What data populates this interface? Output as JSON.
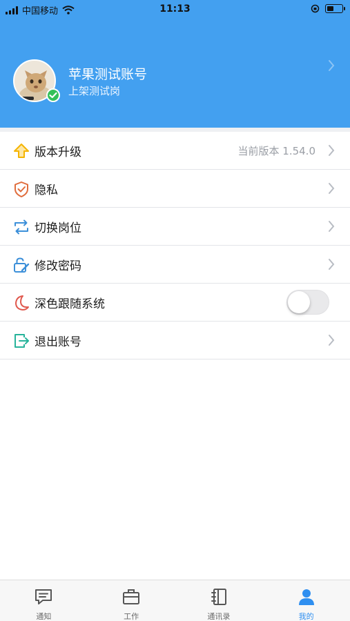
{
  "status_bar": {
    "carrier": "中国移动",
    "time": "11:13",
    "battery_level": 0.45
  },
  "profile": {
    "name": "苹果测试账号",
    "role": "上架测试岗"
  },
  "menu": [
    {
      "label": "版本升级",
      "value": "当前版本 1.54.0",
      "icon": "upgrade-arrow-icon",
      "icon_color": "#f5b400"
    },
    {
      "label": "隐私",
      "icon": "shield-icon",
      "icon_color": "#e06c3c"
    },
    {
      "label": "切换岗位",
      "icon": "switch-icon",
      "icon_color": "#3b8fd9"
    },
    {
      "label": "修改密码",
      "icon": "lock-edit-icon",
      "icon_color": "#3b8fd9"
    },
    {
      "label": "深色跟随系统",
      "icon": "moon-icon",
      "icon_color": "#e0594e",
      "toggle_on": false
    },
    {
      "label": "退出账号",
      "icon": "logout-icon",
      "icon_color": "#26b39a"
    }
  ],
  "tabs": [
    {
      "label": "通知",
      "icon": "chat-icon",
      "active": false
    },
    {
      "label": "工作",
      "icon": "briefcase-icon",
      "active": false
    },
    {
      "label": "通讯录",
      "icon": "contacts-book-icon",
      "active": false
    },
    {
      "label": "我的",
      "icon": "person-icon",
      "active": true
    }
  ],
  "colors": {
    "header_blue": "#43a0f0",
    "tab_active": "#2f8ff0"
  }
}
